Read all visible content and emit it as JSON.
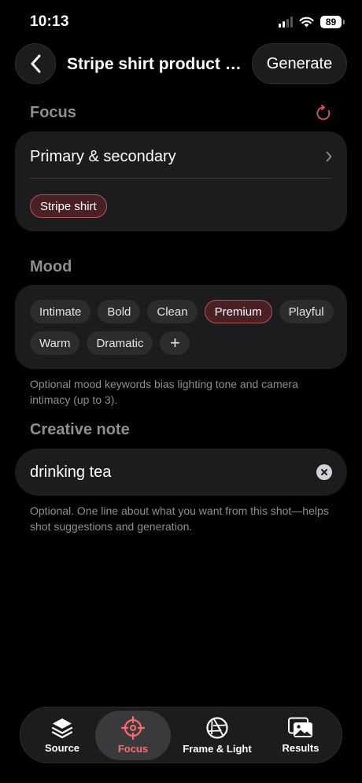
{
  "status": {
    "time": "10:13",
    "battery": "89"
  },
  "header": {
    "title": "Stripe shirt product S...",
    "generate_label": "Generate"
  },
  "focus": {
    "title": "Focus",
    "row_label": "Primary & secondary",
    "chips": [
      "Stripe shirt"
    ]
  },
  "mood": {
    "title": "Mood",
    "chips": [
      "Intimate",
      "Bold",
      "Clean",
      "Premium",
      "Playful",
      "Warm",
      "Dramatic"
    ],
    "selected": "Premium",
    "add_label": "+",
    "helper": "Optional mood keywords bias lighting tone and camera intimacy (up to 3)."
  },
  "creative_note": {
    "title": "Creative note",
    "value": "drinking tea",
    "helper": "Optional. One line about what you want from this shot—helps shot suggestions and generation."
  },
  "tabs": [
    {
      "label": "Source",
      "icon": "layers-icon"
    },
    {
      "label": "Focus",
      "icon": "crosshair-icon",
      "active": true
    },
    {
      "label": "Frame & Light",
      "icon": "aperture-icon"
    },
    {
      "label": "Results",
      "icon": "photos-icon"
    }
  ],
  "colors": {
    "accent": "#ff6b6b",
    "selected_chip_bg": "#4a2024",
    "card_bg": "#1c1c1e"
  }
}
